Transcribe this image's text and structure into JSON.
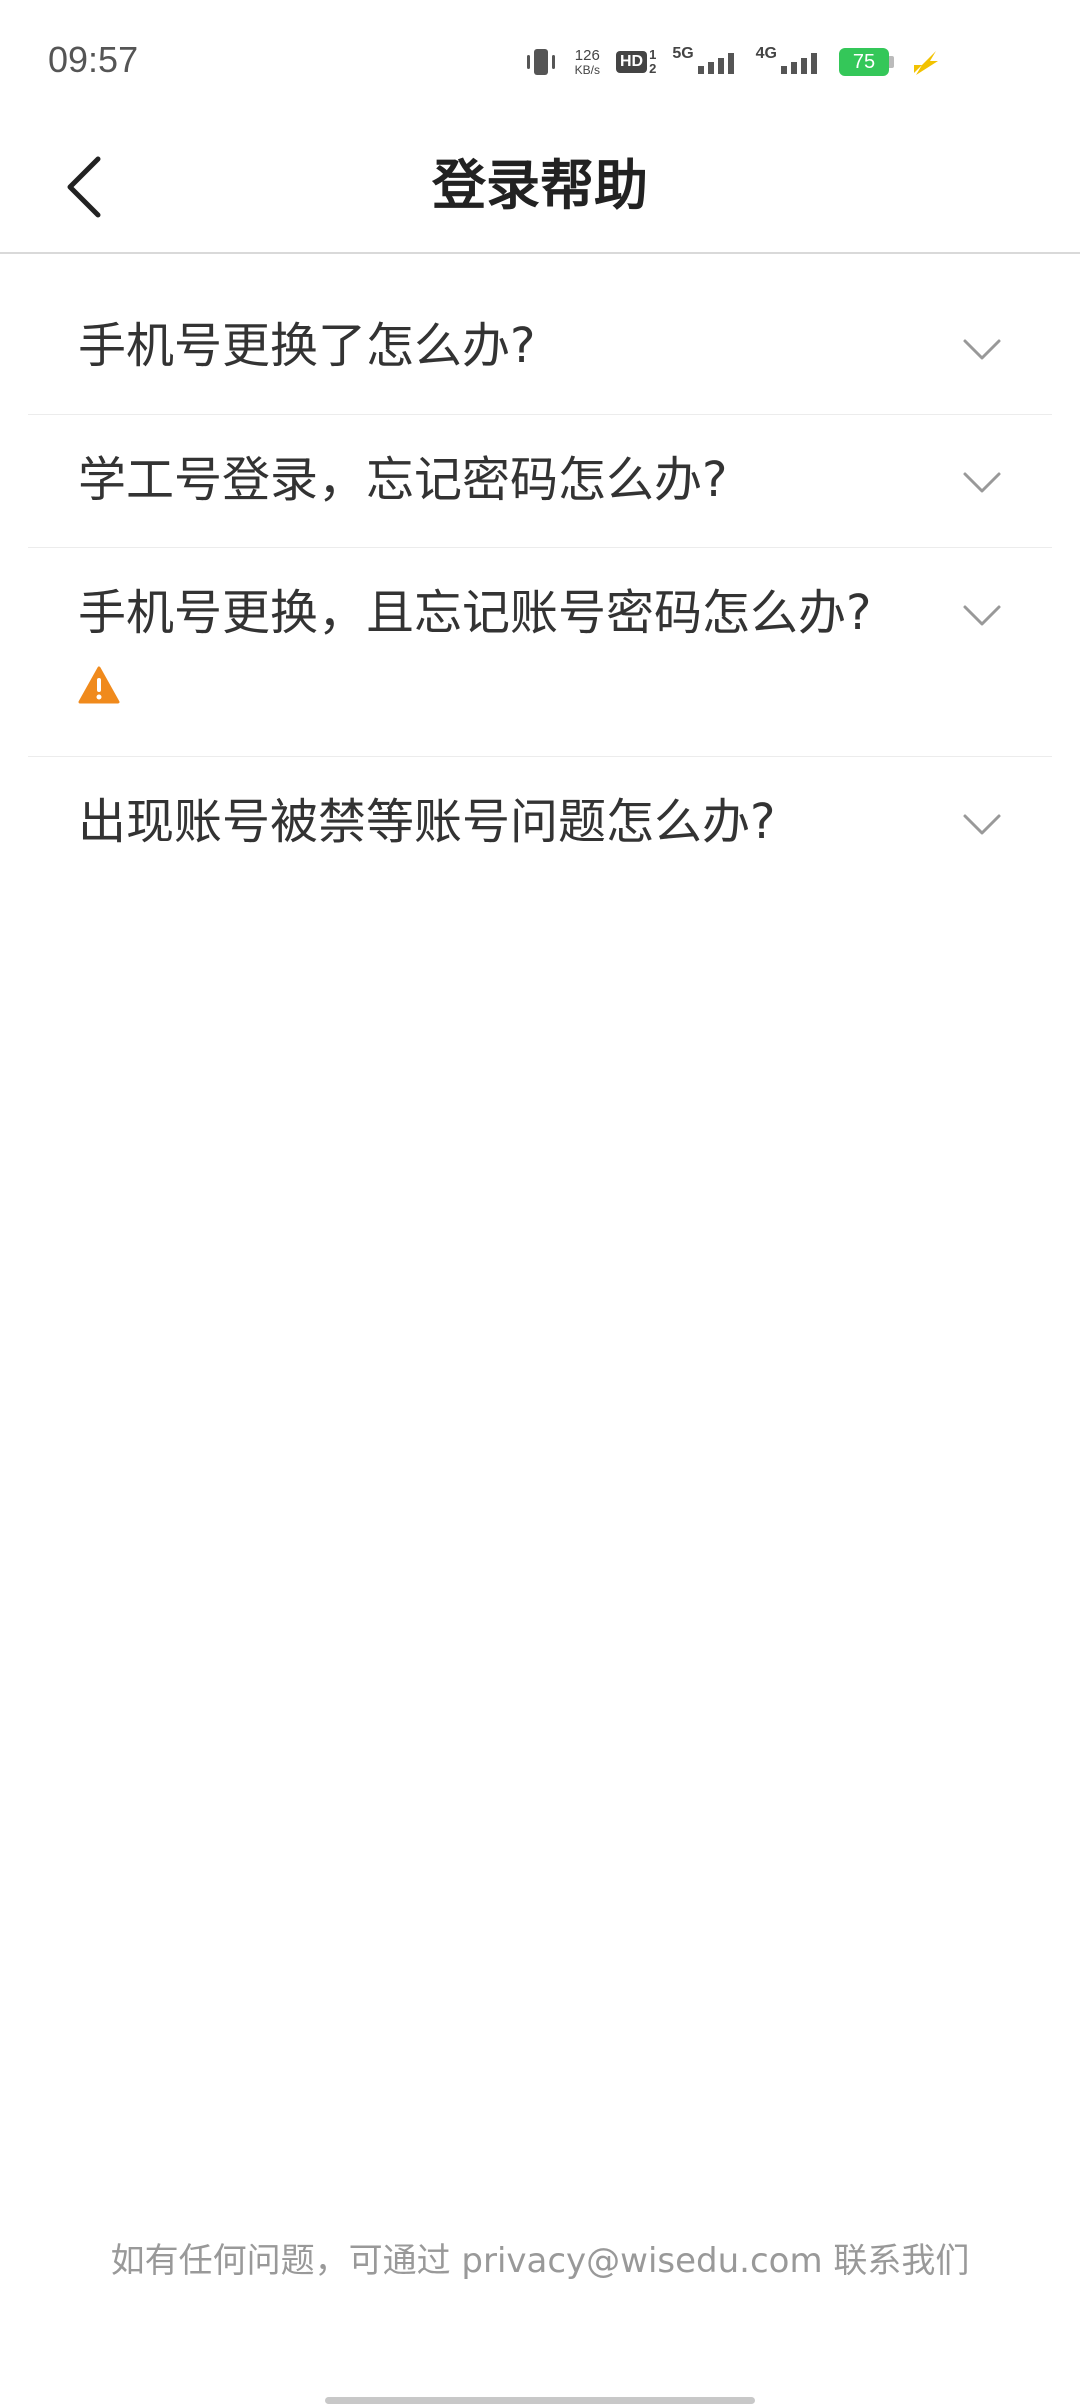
{
  "status_bar": {
    "time": "09:57",
    "net_speed_value": "126",
    "net_speed_unit": "KB/s",
    "hd_label": "HD",
    "sim1": "1",
    "sim2": "2",
    "net1": "5G",
    "net2": "4G",
    "battery": "75",
    "icons": [
      "vibrate-icon",
      "hd-icon",
      "signal-5g-icon",
      "signal-4g-icon",
      "battery-icon",
      "charging-icon"
    ]
  },
  "header": {
    "title": "登录帮助",
    "back_icon": "chevron-left-icon"
  },
  "faq": {
    "items": [
      {
        "question": "手机号更换了怎么办?"
      },
      {
        "question": "学工号登录，忘记密码怎么办?"
      },
      {
        "question": "手机号更换，且忘记账号密码怎么办?",
        "has_warning": true
      },
      {
        "question": "出现账号被禁等账号问题怎么办?"
      }
    ],
    "expand_icon": "chevron-down-icon"
  },
  "footer": {
    "contact_text": "如有任何问题，可通过 privacy@wisedu.com 联系我们"
  },
  "colors": {
    "warning": "#f08a1c",
    "battery": "#34c759",
    "charging": "#f2c200",
    "divider": "#ececec"
  }
}
